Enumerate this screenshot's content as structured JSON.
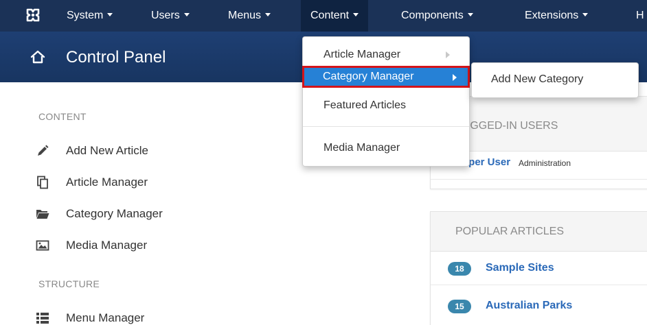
{
  "nav": {
    "items": [
      {
        "label": "System"
      },
      {
        "label": "Users"
      },
      {
        "label": "Menus"
      },
      {
        "label": "Content"
      },
      {
        "label": "Components"
      },
      {
        "label": "Extensions"
      },
      {
        "label": "H"
      }
    ]
  },
  "header": {
    "title": "Control Panel"
  },
  "sidebar": {
    "content_title": "CONTENT",
    "content_items": [
      {
        "label": "Add New Article",
        "icon": "pencil-icon"
      },
      {
        "label": "Article Manager",
        "icon": "copy-icon"
      },
      {
        "label": "Category Manager",
        "icon": "folder-icon"
      },
      {
        "label": "Media Manager",
        "icon": "image-icon"
      }
    ],
    "structure_title": "STRUCTURE",
    "structure_items": [
      {
        "label": "Menu Manager",
        "icon": "list-icon"
      }
    ]
  },
  "logged_in": {
    "title": "LOGGED-IN USERS",
    "user_name": "Super User",
    "user_role": "Administration"
  },
  "popular": {
    "title": "POPULAR ARTICLES",
    "articles": [
      {
        "hits": "18",
        "title": "Sample Sites"
      },
      {
        "hits": "15",
        "title": "Australian Parks"
      }
    ]
  },
  "dropdown": {
    "items": [
      {
        "label": "Article Manager"
      },
      {
        "label": "Category Manager"
      },
      {
        "label": "Featured Articles"
      },
      {
        "label": "Media Manager"
      }
    ],
    "submenu_label": "Add New Category"
  },
  "colors": {
    "nav_bg": "#1b3257",
    "header_bg": "#1e3f73",
    "accent": "#2681d6",
    "highlight_border": "#d4141a",
    "link": "#2a69b8",
    "badge": "#3a87ad"
  }
}
